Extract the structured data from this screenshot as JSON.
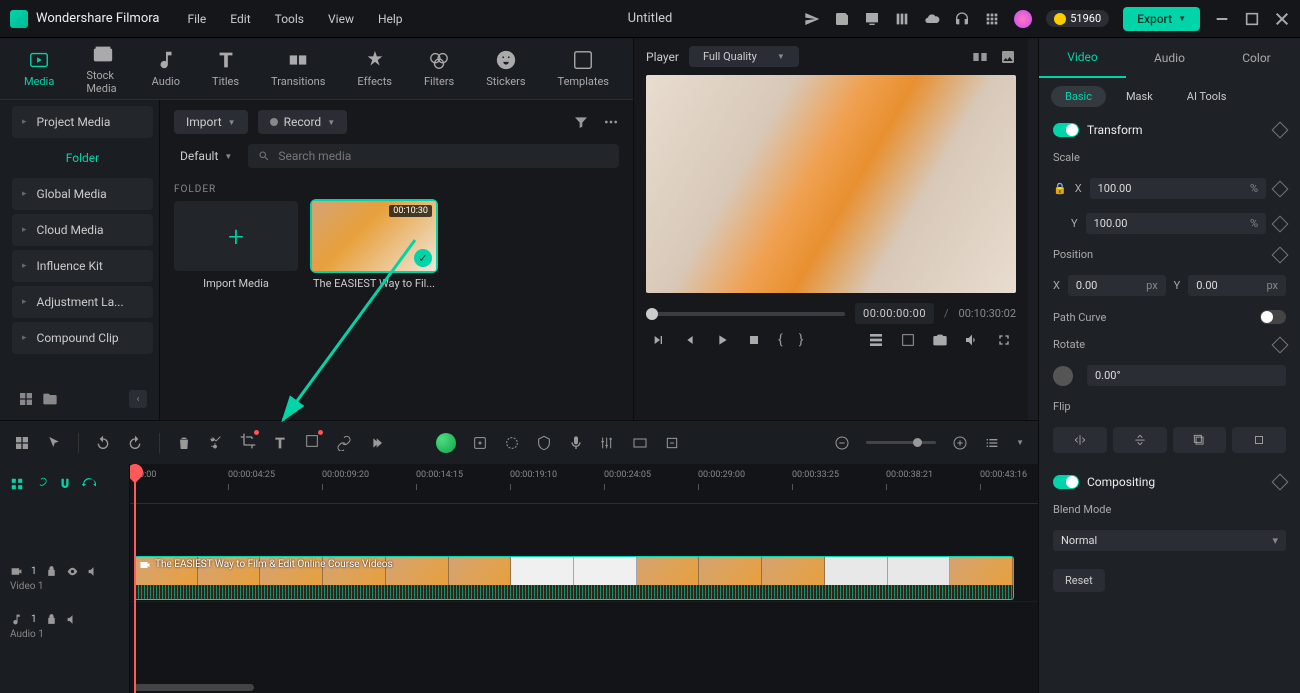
{
  "app": {
    "name": "Wondershare Filmora",
    "doc": "Untitled",
    "menus": [
      "File",
      "Edit",
      "Tools",
      "View",
      "Help"
    ],
    "coins": "51960",
    "export": "Export"
  },
  "tabs": [
    {
      "l": "Media"
    },
    {
      "l": "Stock Media"
    },
    {
      "l": "Audio"
    },
    {
      "l": "Titles"
    },
    {
      "l": "Transitions"
    },
    {
      "l": "Effects"
    },
    {
      "l": "Filters"
    },
    {
      "l": "Stickers"
    },
    {
      "l": "Templates"
    }
  ],
  "sidebar": {
    "top": "Project Media",
    "active": "Folder",
    "items": [
      "Global Media",
      "Cloud Media",
      "Influence Kit",
      "Adjustment La...",
      "Compound Clip"
    ]
  },
  "media": {
    "import": "Import",
    "record": "Record",
    "sort": "Default",
    "search_ph": "Search media",
    "folder": "FOLDER",
    "thumbs": [
      {
        "cap": "Import Media"
      },
      {
        "cap": "The EASIEST Way to Fil...",
        "dur": "00:10:30"
      }
    ]
  },
  "preview": {
    "player": "Player",
    "quality": "Full Quality",
    "cur": "00:00:00:00",
    "sep": "/",
    "total": "00:10:30:02"
  },
  "props": {
    "tabs": [
      "Video",
      "Audio",
      "Color"
    ],
    "subtabs": [
      "Basic",
      "Mask",
      "AI Tools"
    ],
    "transform": "Transform",
    "scale": "Scale",
    "x": "X",
    "y": "Y",
    "scale_x": "100.00",
    "scale_y": "100.00",
    "pct": "%",
    "position": "Position",
    "pos_x": "0.00",
    "pos_y": "0.00",
    "px": "px",
    "pathcurve": "Path Curve",
    "rotate": "Rotate",
    "rot_val": "0.00°",
    "flip": "Flip",
    "compositing": "Compositing",
    "blend": "Blend Mode",
    "blend_val": "Normal",
    "reset": "Reset"
  },
  "ruler": [
    "00:00",
    "00:00:04:25",
    "00:00:09:20",
    "00:00:14:15",
    "00:00:19:10",
    "00:00:24:05",
    "00:00:29:00",
    "00:00:33:25",
    "00:00:38:21",
    "00:00:43:16"
  ],
  "tracks": {
    "v": "Video 1",
    "a": "Audio 1",
    "clip": "The EASIEST Way to Film & Edit Online Course Videos"
  }
}
